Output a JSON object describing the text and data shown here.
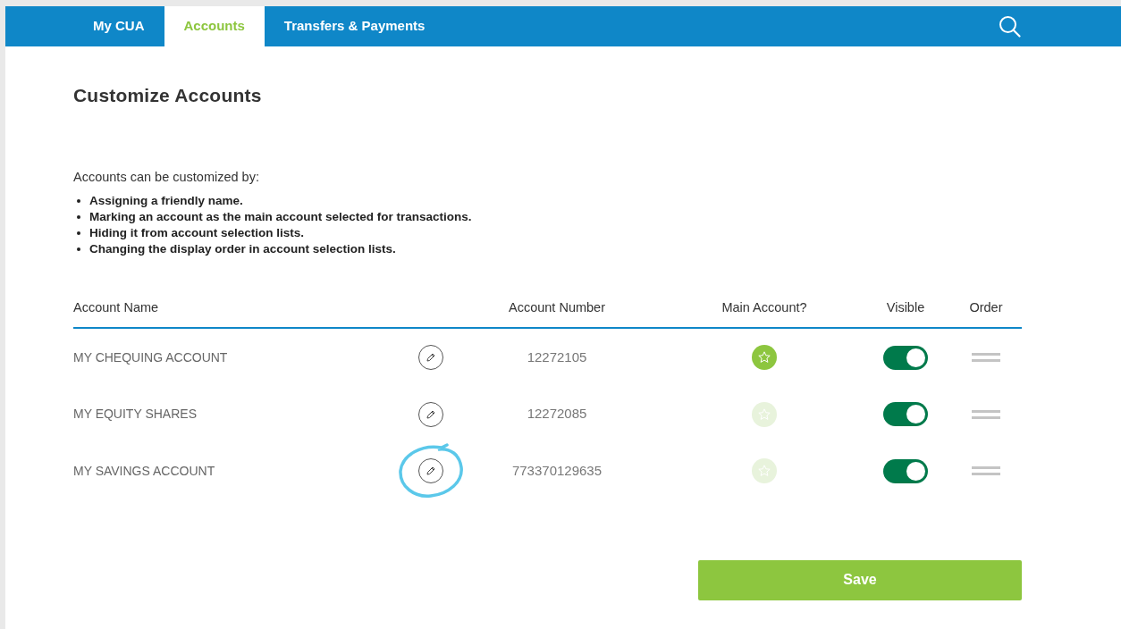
{
  "nav": {
    "tabs": [
      {
        "label": "My CUA",
        "selected": false
      },
      {
        "label": "Accounts",
        "selected": true
      },
      {
        "label": "Transfers & Payments",
        "selected": false
      }
    ]
  },
  "title": "Customize Accounts",
  "intro": "Accounts can be customized by:",
  "bullets": [
    "Assigning a friendly name.",
    "Marking an account as the main account selected for transactions.",
    "Hiding it from account selection lists.",
    "Changing the display order in account selection lists."
  ],
  "table": {
    "columns": [
      "Account Name",
      "Account Number",
      "Main Account?",
      "Visible",
      "Order"
    ],
    "rows": [
      {
        "name": "MY CHEQUING ACCOUNT",
        "number": "12272105",
        "main": true,
        "visible": true,
        "highlighted": false
      },
      {
        "name": "MY EQUITY SHARES",
        "number": "12272085",
        "main": false,
        "visible": true,
        "highlighted": false
      },
      {
        "name": "MY SAVINGS ACCOUNT",
        "number": "773370129635",
        "main": false,
        "visible": true,
        "highlighted": true
      }
    ]
  },
  "save_button": "Save"
}
